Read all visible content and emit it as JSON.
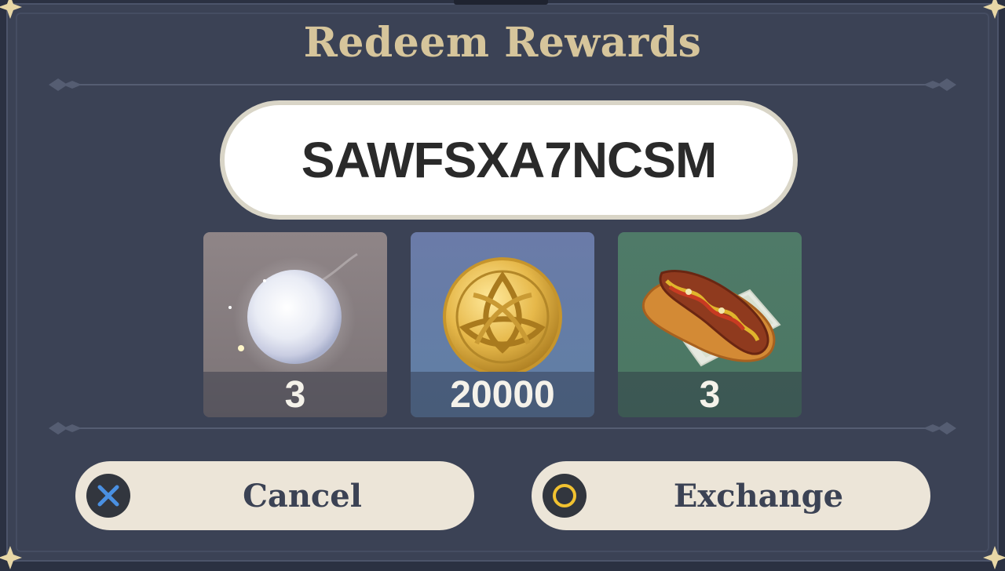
{
  "dialog": {
    "title": "Redeem Rewards",
    "code": "SAWFSXA7NCSM"
  },
  "rewards": [
    {
      "icon": "moon-orb-icon",
      "quantity": "3"
    },
    {
      "icon": "mora-coin-icon",
      "quantity": "20000"
    },
    {
      "icon": "hotdog-dish-icon",
      "quantity": "3"
    }
  ],
  "buttons": {
    "cancel": {
      "label": "Cancel",
      "icon": "cross-icon"
    },
    "exchange": {
      "label": "Exchange",
      "icon": "circle-icon"
    }
  },
  "colors": {
    "background": "#3b4255",
    "title": "#d6c59b",
    "button_bg": "#ece5d8",
    "button_text": "#3b4254",
    "cross_icon": "#4a90e2",
    "circle_icon": "#f2c230"
  }
}
